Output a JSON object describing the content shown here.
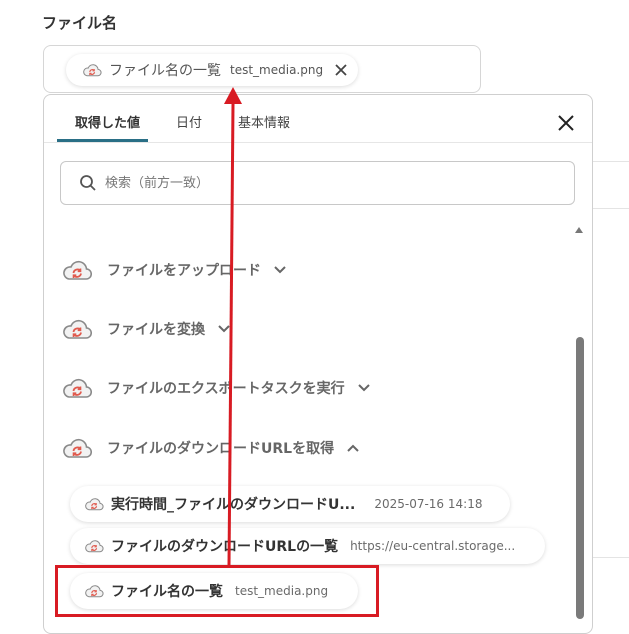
{
  "field": {
    "label": "ファイル名",
    "chip_title": "ファイル名の一覧",
    "chip_value": "test_media.png"
  },
  "panel": {
    "tabs": [
      {
        "label": "取得した値",
        "active": true
      },
      {
        "label": "日付",
        "active": false
      },
      {
        "label": "基本情報",
        "active": false
      }
    ],
    "search_placeholder": "検索（前方一致）",
    "groups": [
      {
        "label": "ファイルをアップロード",
        "expanded": false
      },
      {
        "label": "ファイルを変換",
        "expanded": false
      },
      {
        "label": "ファイルのエクスポートタスクを実行",
        "expanded": false
      },
      {
        "label": "ファイルのダウンロードURLを取得",
        "expanded": true
      }
    ],
    "items": [
      {
        "title": "実行時間_ファイルのダウンロードU...",
        "value": "2025-07-16 14:18"
      },
      {
        "title": "ファイルのダウンロードURLの一覧",
        "value": "https://eu-central.storage..."
      },
      {
        "title": "ファイル名の一覧",
        "value": "test_media.png"
      }
    ]
  },
  "colors": {
    "accent": "#2a6f86",
    "highlight": "#d81b23",
    "app_icon": "#e05a4e"
  },
  "icons": {
    "app": "cloud-sync-icon",
    "remove": "close-icon",
    "panel_close": "close-icon",
    "search": "search-icon",
    "expand": "chevron-down-icon",
    "collapse": "chevron-up-icon"
  }
}
